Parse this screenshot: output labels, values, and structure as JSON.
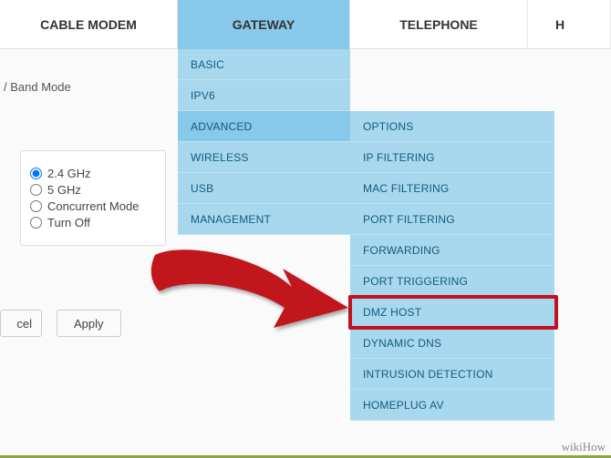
{
  "topnav": {
    "cable": "CABLE MODEM",
    "gateway": "GATEWAY",
    "telephone": "TELEPHONE",
    "partial": "H"
  },
  "side_label": "/ Band Mode",
  "radio": {
    "opt1": "2.4 GHz",
    "opt2": "5 GHz",
    "opt3": "Concurrent Mode",
    "opt4": "Turn Off"
  },
  "buttons": {
    "cancel": "cel",
    "apply": "Apply"
  },
  "gateway_menu": [
    "BASIC",
    "IPV6",
    "ADVANCED",
    "WIRELESS",
    "USB",
    "MANAGEMENT"
  ],
  "advanced_submenu": [
    "OPTIONS",
    "IP FILTERING",
    "MAC FILTERING",
    "PORT FILTERING",
    "FORWARDING",
    "PORT TRIGGERING",
    "DMZ HOST",
    "DYNAMIC DNS",
    "INTRUSION DETECTION",
    "HOMEPLUG AV"
  ],
  "highlighted_item": "DMZ HOST",
  "watermark": "wikiHow"
}
